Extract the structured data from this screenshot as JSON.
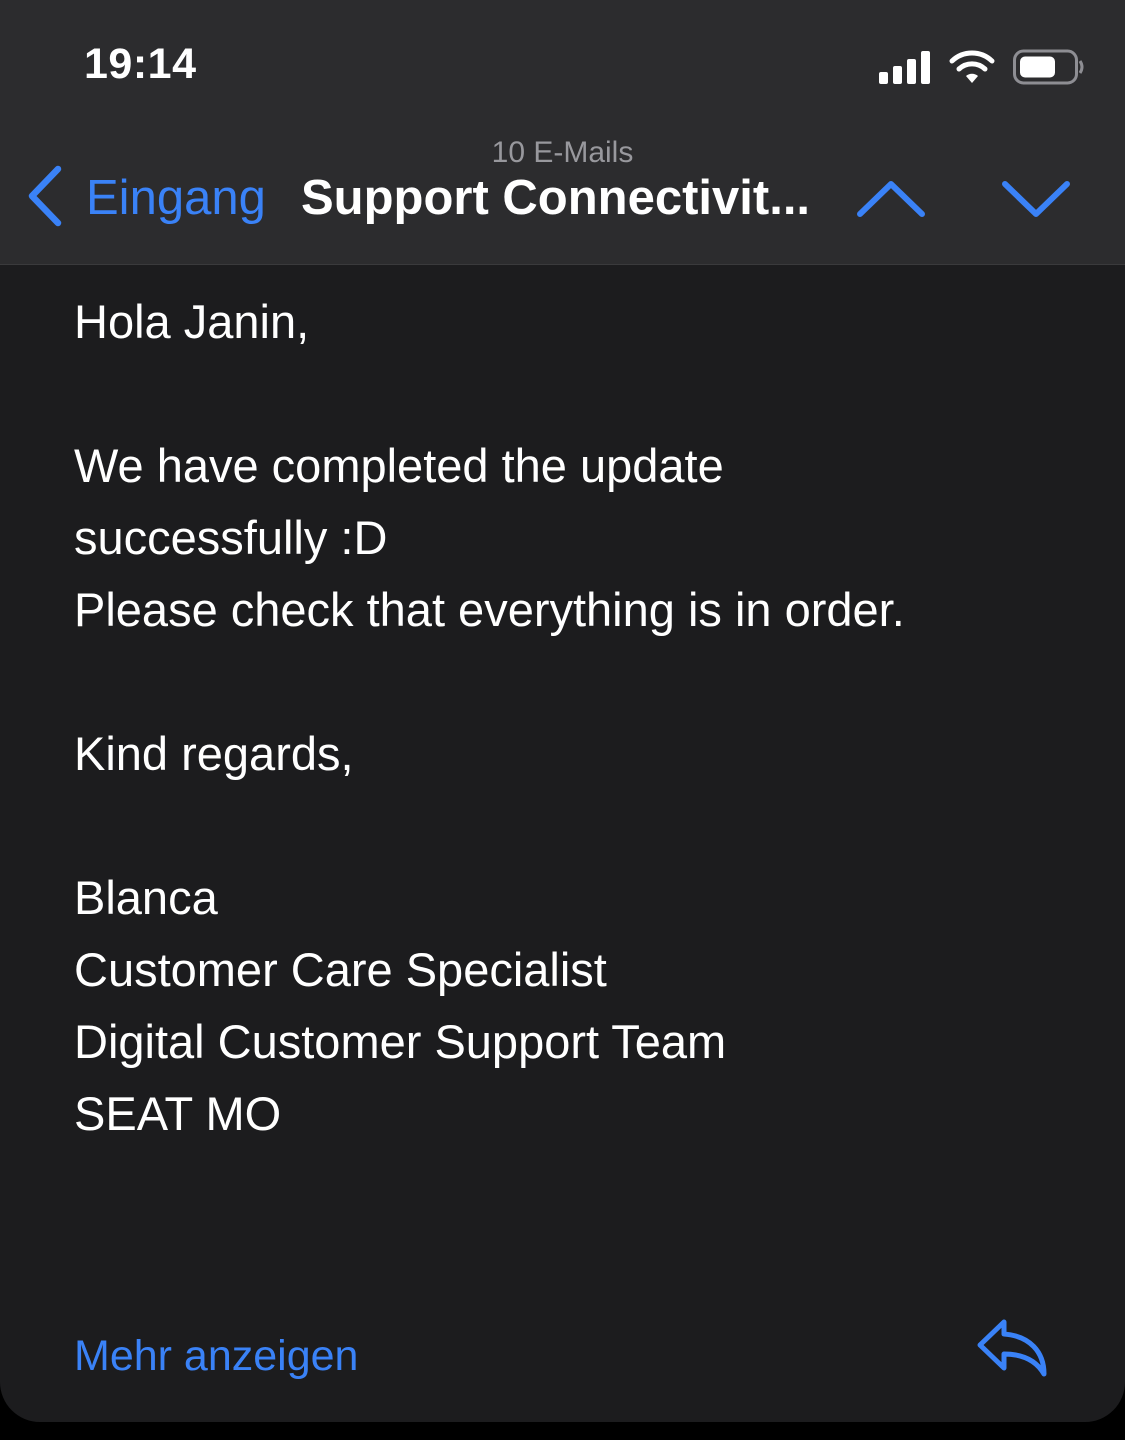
{
  "status_bar": {
    "time": "19:14",
    "icons": [
      "cellular-signal-icon",
      "wifi-icon",
      "battery-icon"
    ]
  },
  "nav": {
    "subtitle": "10 E-Mails",
    "back_label": "Eingang",
    "title": "Support Connectivit...",
    "icons": [
      "chevron-left-icon",
      "chevron-up-icon",
      "chevron-down-icon"
    ]
  },
  "mail": {
    "greeting": "Hola Janin,",
    "body_line_1": "We have completed the update",
    "body_line_2": "successfully :D",
    "body_line_3": "Please check that everything is in order.",
    "closing": "Kind regards,",
    "signature_name": "Blanca",
    "signature_role": "Customer Care Specialist",
    "signature_team": "Digital Customer Support Team",
    "signature_company": "SEAT MO"
  },
  "footer": {
    "more_label": "Mehr anzeigen",
    "reply_icon": "reply-icon"
  },
  "colors": {
    "accent": "#3a82f7",
    "background": "#1c1c1e",
    "header_background": "#2c2c2e",
    "text": "#ffffff",
    "secondary_text": "#98989d"
  }
}
